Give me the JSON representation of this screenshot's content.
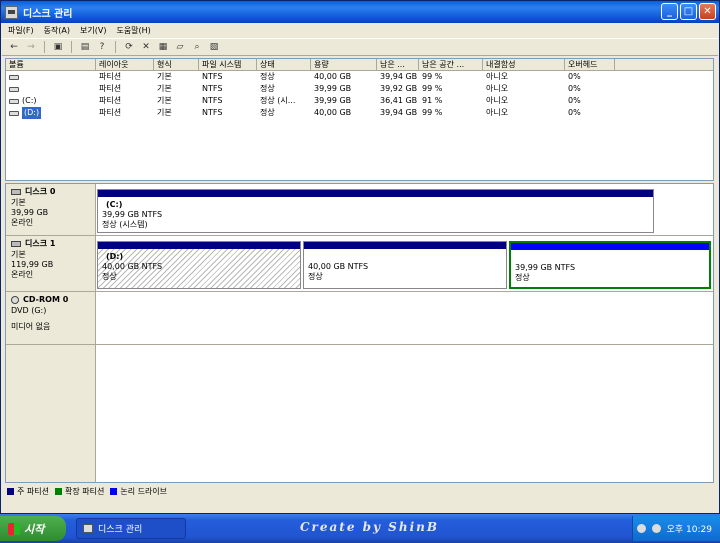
{
  "window": {
    "title": "디스크 관리"
  },
  "menu": [
    "파일(F)",
    "동작(A)",
    "보기(V)",
    "도움말(H)"
  ],
  "toolbar": {
    "icons": [
      "back-arrow-icon",
      "forward-arrow-icon",
      "console-tree-icon",
      "properties-icon",
      "help-icon",
      "refresh-icon",
      "delete-icon",
      "disk-properties-icon",
      "open-icon",
      "search-icon",
      "wizard-icon"
    ]
  },
  "list": {
    "columns": [
      "볼륨",
      "레이아웃",
      "형식",
      "파일 시스템",
      "상태",
      "용량",
      "남은 ...",
      "남은 공간 ...",
      "내결함성",
      "오버헤드"
    ],
    "rows": [
      {
        "volume": "",
        "layout": "파티션",
        "type": "기본",
        "fs": "NTFS",
        "status": "정상",
        "capacity": "40,00 GB",
        "free": "39,94 GB",
        "free_pct": "99 %",
        "fault": "아니오",
        "overhead": "0%"
      },
      {
        "volume": "",
        "layout": "파티션",
        "type": "기본",
        "fs": "NTFS",
        "status": "정상",
        "capacity": "39,99 GB",
        "free": "39,92 GB",
        "free_pct": "99 %",
        "fault": "아니오",
        "overhead": "0%"
      },
      {
        "volume": "(C:)",
        "layout": "파티션",
        "type": "기본",
        "fs": "NTFS",
        "status": "정상 (시...",
        "capacity": "39,99 GB",
        "free": "36,41 GB",
        "free_pct": "91 %",
        "fault": "아니오",
        "overhead": "0%"
      },
      {
        "volume": "(D:)",
        "layout": "파티션",
        "type": "기본",
        "fs": "NTFS",
        "status": "정상",
        "capacity": "40,00 GB",
        "free": "39,94 GB",
        "free_pct": "99 %",
        "fault": "아니오",
        "overhead": "0%"
      }
    ]
  },
  "disks": [
    {
      "name": "디스크 0",
      "kind": "기본",
      "size": "39,99 GB",
      "state": "온라인"
    },
    {
      "name": "디스크 1",
      "kind": "기본",
      "size": "119,99 GB",
      "state": "온라인"
    },
    {
      "name": "CD-ROM 0",
      "kind": "DVD (G:)",
      "size": "",
      "state": "미디어 없음"
    }
  ],
  "partitions": [
    {
      "name": "(C:)",
      "size": "39,99 GB NTFS",
      "status": "정상 (시스템)"
    },
    {
      "name": "(D:)",
      "size": "40,00 GB NTFS",
      "status": "정상"
    },
    {
      "name": "",
      "size": "40,00 GB NTFS",
      "status": "정상"
    },
    {
      "name": "",
      "size": "39,99 GB NTFS",
      "status": "정상"
    }
  ],
  "legend": [
    {
      "label": "주 파티션",
      "color": "#000080"
    },
    {
      "label": "확장 파티션",
      "color": "#008000"
    },
    {
      "label": "논리 드라이브",
      "color": "#0000ff"
    }
  ],
  "taskbar": {
    "start": "시작",
    "task": "디스크 관리",
    "credit": "Create by ShinB",
    "clock": "오후 10:29"
  }
}
